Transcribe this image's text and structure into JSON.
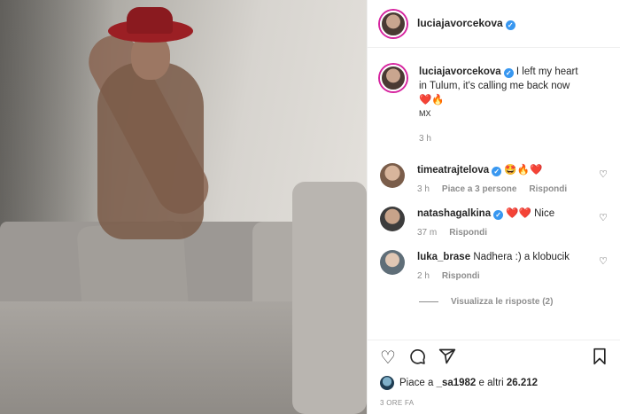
{
  "post": {
    "username": "luciajavorcekova",
    "caption_username": "luciajavorcekova",
    "caption_text": "I left my heart in Tulum, it's calling me back now",
    "caption_emoji": "❤️🔥",
    "caption_location": "MX",
    "caption_time": "3 h"
  },
  "comments": [
    {
      "username": "timeatrajtelova",
      "text": "🤩🔥❤️",
      "time": "3 h",
      "likes": "Piace a 3 persone",
      "reply": "Rispondi"
    },
    {
      "username": "natashagalkina",
      "text": "❤️❤️ Nice",
      "time": "37 m",
      "reply": "Rispondi"
    },
    {
      "username": "luka_brase",
      "text": "Nadhera :) a klobucik",
      "time": "2 h",
      "reply": "Rispondi",
      "view_replies": "Visualizza le risposte (2)"
    }
  ],
  "footer": {
    "likes_prefix": "Piace a",
    "likes_user": "_sa1982",
    "likes_suffix": "e altri",
    "likes_count": "26.212",
    "posted_time": "3 ORE FA"
  },
  "icons": {
    "like": "heart-outline-icon",
    "comment": "comment-bubble-icon",
    "share": "paper-plane-icon",
    "save": "bookmark-icon",
    "verified": "verified-badge-icon"
  },
  "colors": {
    "verified": "#3897f0",
    "story_ring": "#d6249f",
    "muted_text": "#8e8e8e"
  }
}
